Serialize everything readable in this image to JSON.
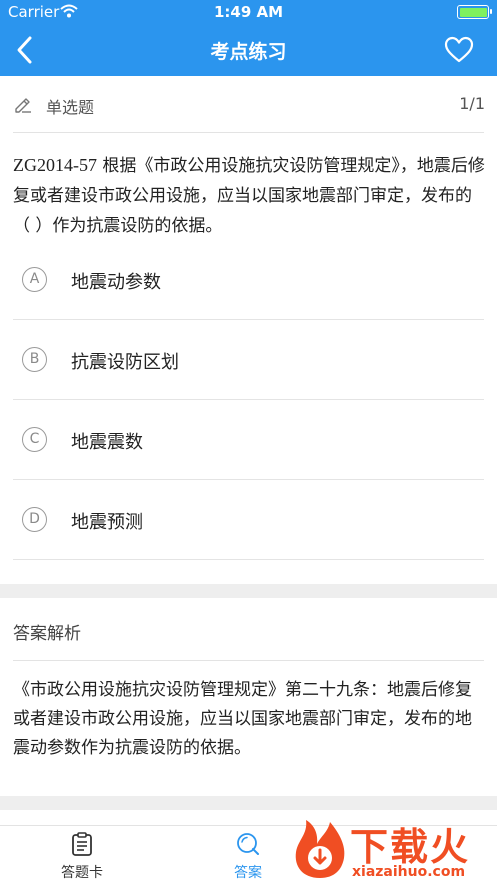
{
  "status_bar": {
    "carrier": "Carrier",
    "time": "1:49 AM"
  },
  "nav": {
    "title": "考点练习"
  },
  "question": {
    "type_label": "单选题",
    "counter": "1/1",
    "code": "ZG2014-57",
    "text": " 根据《市政公用设施抗灾设防管理规定》，地震后修复或者建设市政公用设施，应当以国家地震部门审定，发布的（   ）作为抗震设防的依据。"
  },
  "options": [
    {
      "letter": "A",
      "text": "地震动参数"
    },
    {
      "letter": "B",
      "text": "抗震设防区划"
    },
    {
      "letter": "C",
      "text": "地震震数"
    },
    {
      "letter": "D",
      "text": "地震预测"
    }
  ],
  "analysis": {
    "heading": "答案解析",
    "text": "《市政公用设施抗灾设防管理规定》第二十九条：地震后修复或者建设市政公用设施，应当以国家地震部门审定，发布的地震动参数作为抗震设防的依据。"
  },
  "tabs": [
    {
      "label": "答题卡",
      "icon": "clipboard-icon"
    },
    {
      "label": "答案",
      "icon": "search-icon"
    }
  ],
  "watermark": {
    "big": "下载火",
    "small": "xiazaihuo.com"
  },
  "colors": {
    "primary": "#2b95ee",
    "watermark": "#f04e23",
    "battery": "#7ff05f"
  }
}
